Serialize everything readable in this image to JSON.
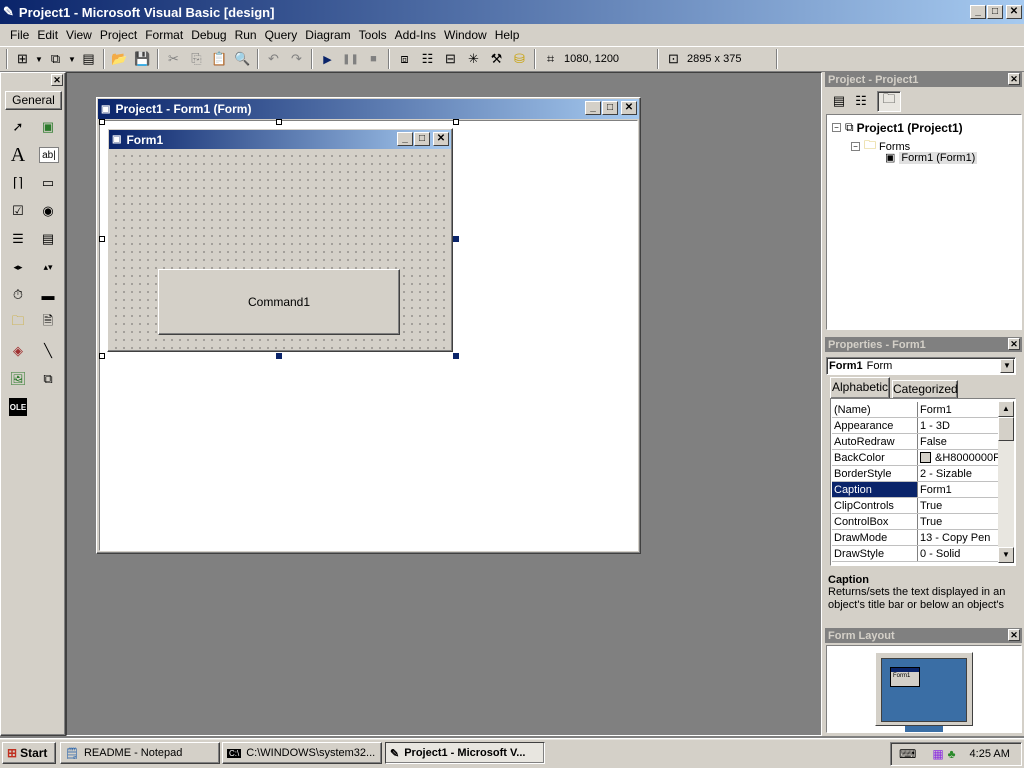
{
  "app": {
    "title": "Project1 - Microsoft Visual Basic [design]"
  },
  "menu": [
    "File",
    "Edit",
    "View",
    "Project",
    "Format",
    "Debug",
    "Run",
    "Query",
    "Diagram",
    "Tools",
    "Add-Ins",
    "Window",
    "Help"
  ],
  "toolbar": {
    "position": "1080, 1200",
    "size": "2895 x 375"
  },
  "toolbox": {
    "tab": "General"
  },
  "designer": {
    "title": "Project1 - Form1 (Form)",
    "form_caption": "Form1",
    "button_caption": "Command1"
  },
  "project": {
    "title": "Project - Project1",
    "root": "Project1 (Project1)",
    "folder": "Forms",
    "form": "Form1 (Form1)"
  },
  "properties": {
    "title": "Properties - Form1",
    "object_name": "Form1",
    "object_type": "Form",
    "tab_alpha": "Alphabetic",
    "tab_cat": "Categorized",
    "rows": [
      {
        "key": "(Name)",
        "value": "Form1"
      },
      {
        "key": "Appearance",
        "value": "1 - 3D"
      },
      {
        "key": "AutoRedraw",
        "value": "False"
      },
      {
        "key": "BackColor",
        "value": "&H8000000F"
      },
      {
        "key": "BorderStyle",
        "value": "2 - Sizable"
      },
      {
        "key": "Caption",
        "value": "Form1"
      },
      {
        "key": "ClipControls",
        "value": "True"
      },
      {
        "key": "ControlBox",
        "value": "True"
      },
      {
        "key": "DrawMode",
        "value": "13 - Copy Pen"
      },
      {
        "key": "DrawStyle",
        "value": "0 - Solid"
      }
    ],
    "desc_title": "Caption",
    "desc_text": "Returns/sets the text displayed in an object's title bar or below an object's"
  },
  "layout": {
    "title": "Form Layout",
    "mini_caption": "Form1"
  },
  "taskbar": {
    "start": "Start",
    "tasks": [
      "README - Notepad",
      "C:\\WINDOWS\\system32...",
      "Project1 - Microsoft V..."
    ],
    "clock": "4:25 AM"
  },
  "colors": {
    "title_active": "#0a246a",
    "face": "#d4d0c8",
    "mdi_bg": "#808080",
    "monitor_blue": "#3a6ea5"
  }
}
